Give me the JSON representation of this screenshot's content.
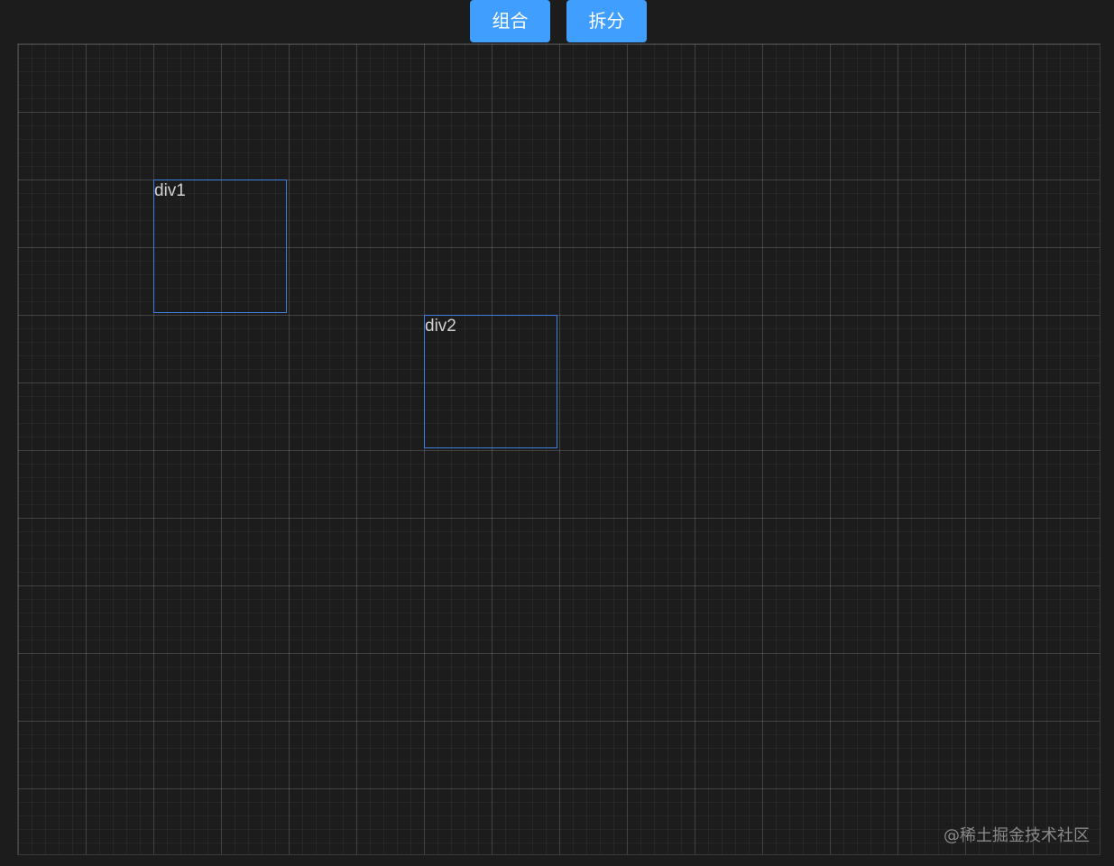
{
  "toolbar": {
    "combine_label": "组合",
    "split_label": "拆分"
  },
  "canvas": {
    "elements": [
      {
        "label": "div1"
      },
      {
        "label": "div2"
      }
    ]
  },
  "watermark": "@稀土掘金技术社区",
  "colors": {
    "background": "#1c1c1c",
    "button": "#409eff",
    "element_border": "#3f7fe0"
  }
}
